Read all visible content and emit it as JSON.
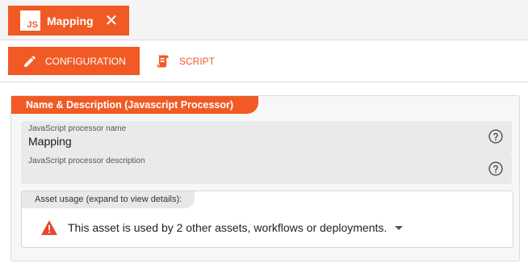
{
  "file_tab": {
    "badge": "JS",
    "label": "Mapping",
    "close_glyph": "✕"
  },
  "subtabs": [
    {
      "label": "CONFIGURATION",
      "icon": "pencil-icon",
      "active": true
    },
    {
      "label": "SCRIPT",
      "icon": "scroll-icon",
      "active": false
    }
  ],
  "panel": {
    "title": "Name & Description (Javascript Processor)",
    "fields": {
      "name_label": "JavaScript processor name",
      "name_value": "Mapping",
      "description_label": "JavaScript processor description",
      "description_value": ""
    },
    "asset_usage": {
      "header": "Asset usage (expand to view details):",
      "message": "This asset is used by 2 other assets, workflows or deployments."
    }
  },
  "colors": {
    "accent": "#f15a24",
    "warning": "#e8452c"
  }
}
